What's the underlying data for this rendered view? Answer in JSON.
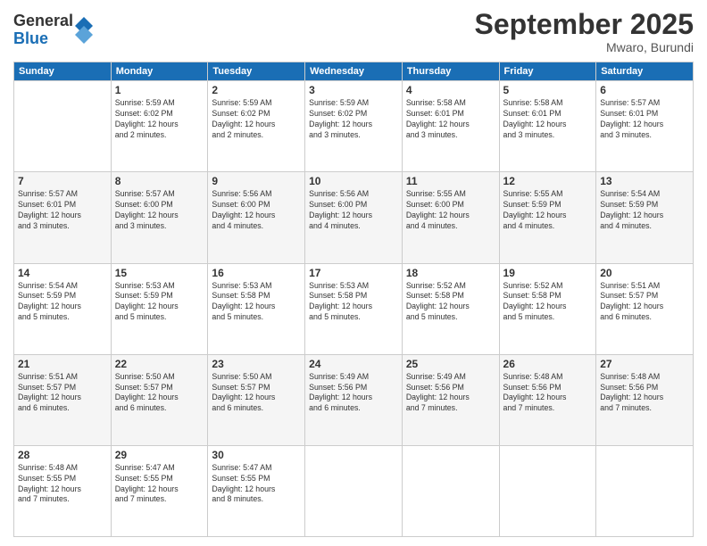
{
  "header": {
    "logo_general": "General",
    "logo_blue": "Blue",
    "month_title": "September 2025",
    "subtitle": "Mwaro, Burundi"
  },
  "days_of_week": [
    "Sunday",
    "Monday",
    "Tuesday",
    "Wednesday",
    "Thursday",
    "Friday",
    "Saturday"
  ],
  "weeks": [
    [
      {
        "day": "",
        "info": ""
      },
      {
        "day": "1",
        "info": "Sunrise: 5:59 AM\nSunset: 6:02 PM\nDaylight: 12 hours\nand 2 minutes."
      },
      {
        "day": "2",
        "info": "Sunrise: 5:59 AM\nSunset: 6:02 PM\nDaylight: 12 hours\nand 2 minutes."
      },
      {
        "day": "3",
        "info": "Sunrise: 5:59 AM\nSunset: 6:02 PM\nDaylight: 12 hours\nand 3 minutes."
      },
      {
        "day": "4",
        "info": "Sunrise: 5:58 AM\nSunset: 6:01 PM\nDaylight: 12 hours\nand 3 minutes."
      },
      {
        "day": "5",
        "info": "Sunrise: 5:58 AM\nSunset: 6:01 PM\nDaylight: 12 hours\nand 3 minutes."
      },
      {
        "day": "6",
        "info": "Sunrise: 5:57 AM\nSunset: 6:01 PM\nDaylight: 12 hours\nand 3 minutes."
      }
    ],
    [
      {
        "day": "7",
        "info": "Sunrise: 5:57 AM\nSunset: 6:01 PM\nDaylight: 12 hours\nand 3 minutes."
      },
      {
        "day": "8",
        "info": "Sunrise: 5:57 AM\nSunset: 6:00 PM\nDaylight: 12 hours\nand 3 minutes."
      },
      {
        "day": "9",
        "info": "Sunrise: 5:56 AM\nSunset: 6:00 PM\nDaylight: 12 hours\nand 4 minutes."
      },
      {
        "day": "10",
        "info": "Sunrise: 5:56 AM\nSunset: 6:00 PM\nDaylight: 12 hours\nand 4 minutes."
      },
      {
        "day": "11",
        "info": "Sunrise: 5:55 AM\nSunset: 6:00 PM\nDaylight: 12 hours\nand 4 minutes."
      },
      {
        "day": "12",
        "info": "Sunrise: 5:55 AM\nSunset: 5:59 PM\nDaylight: 12 hours\nand 4 minutes."
      },
      {
        "day": "13",
        "info": "Sunrise: 5:54 AM\nSunset: 5:59 PM\nDaylight: 12 hours\nand 4 minutes."
      }
    ],
    [
      {
        "day": "14",
        "info": "Sunrise: 5:54 AM\nSunset: 5:59 PM\nDaylight: 12 hours\nand 5 minutes."
      },
      {
        "day": "15",
        "info": "Sunrise: 5:53 AM\nSunset: 5:59 PM\nDaylight: 12 hours\nand 5 minutes."
      },
      {
        "day": "16",
        "info": "Sunrise: 5:53 AM\nSunset: 5:58 PM\nDaylight: 12 hours\nand 5 minutes."
      },
      {
        "day": "17",
        "info": "Sunrise: 5:53 AM\nSunset: 5:58 PM\nDaylight: 12 hours\nand 5 minutes."
      },
      {
        "day": "18",
        "info": "Sunrise: 5:52 AM\nSunset: 5:58 PM\nDaylight: 12 hours\nand 5 minutes."
      },
      {
        "day": "19",
        "info": "Sunrise: 5:52 AM\nSunset: 5:58 PM\nDaylight: 12 hours\nand 5 minutes."
      },
      {
        "day": "20",
        "info": "Sunrise: 5:51 AM\nSunset: 5:57 PM\nDaylight: 12 hours\nand 6 minutes."
      }
    ],
    [
      {
        "day": "21",
        "info": "Sunrise: 5:51 AM\nSunset: 5:57 PM\nDaylight: 12 hours\nand 6 minutes."
      },
      {
        "day": "22",
        "info": "Sunrise: 5:50 AM\nSunset: 5:57 PM\nDaylight: 12 hours\nand 6 minutes."
      },
      {
        "day": "23",
        "info": "Sunrise: 5:50 AM\nSunset: 5:57 PM\nDaylight: 12 hours\nand 6 minutes."
      },
      {
        "day": "24",
        "info": "Sunrise: 5:49 AM\nSunset: 5:56 PM\nDaylight: 12 hours\nand 6 minutes."
      },
      {
        "day": "25",
        "info": "Sunrise: 5:49 AM\nSunset: 5:56 PM\nDaylight: 12 hours\nand 7 minutes."
      },
      {
        "day": "26",
        "info": "Sunrise: 5:48 AM\nSunset: 5:56 PM\nDaylight: 12 hours\nand 7 minutes."
      },
      {
        "day": "27",
        "info": "Sunrise: 5:48 AM\nSunset: 5:56 PM\nDaylight: 12 hours\nand 7 minutes."
      }
    ],
    [
      {
        "day": "28",
        "info": "Sunrise: 5:48 AM\nSunset: 5:55 PM\nDaylight: 12 hours\nand 7 minutes."
      },
      {
        "day": "29",
        "info": "Sunrise: 5:47 AM\nSunset: 5:55 PM\nDaylight: 12 hours\nand 7 minutes."
      },
      {
        "day": "30",
        "info": "Sunrise: 5:47 AM\nSunset: 5:55 PM\nDaylight: 12 hours\nand 8 minutes."
      },
      {
        "day": "",
        "info": ""
      },
      {
        "day": "",
        "info": ""
      },
      {
        "day": "",
        "info": ""
      },
      {
        "day": "",
        "info": ""
      }
    ]
  ]
}
